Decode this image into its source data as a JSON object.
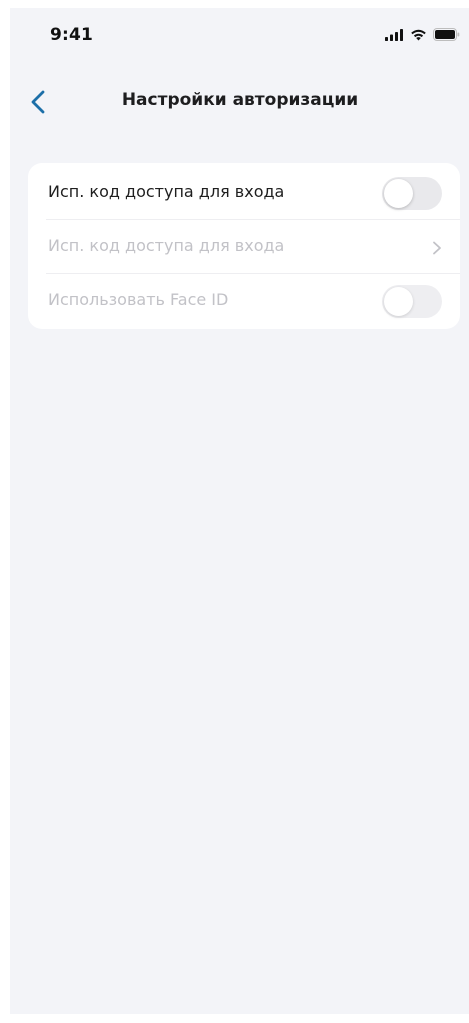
{
  "status_bar": {
    "time": "9:41",
    "icons": [
      "cellular-signal-icon",
      "wifi-icon",
      "battery-icon"
    ]
  },
  "nav": {
    "back_icon": "chevron-left-icon",
    "title": "Настройки авторизации"
  },
  "settings": {
    "rows": [
      {
        "label": "Исп. код доступа для входа",
        "control": "toggle",
        "on": false,
        "enabled": true
      },
      {
        "label": "Исп. код доступа для входа",
        "control": "chevron",
        "icon": "chevron-right-icon",
        "enabled": false
      },
      {
        "label": "Использовать Face ID",
        "control": "toggle",
        "on": false,
        "enabled": false
      }
    ]
  },
  "colors": {
    "background": "#f3f4f8",
    "card": "#ffffff",
    "accent": "#1c6fa8",
    "text_primary": "#1f1f1f",
    "text_disabled": "#c2c2c7",
    "toggle_off": "#e9e9ec"
  }
}
